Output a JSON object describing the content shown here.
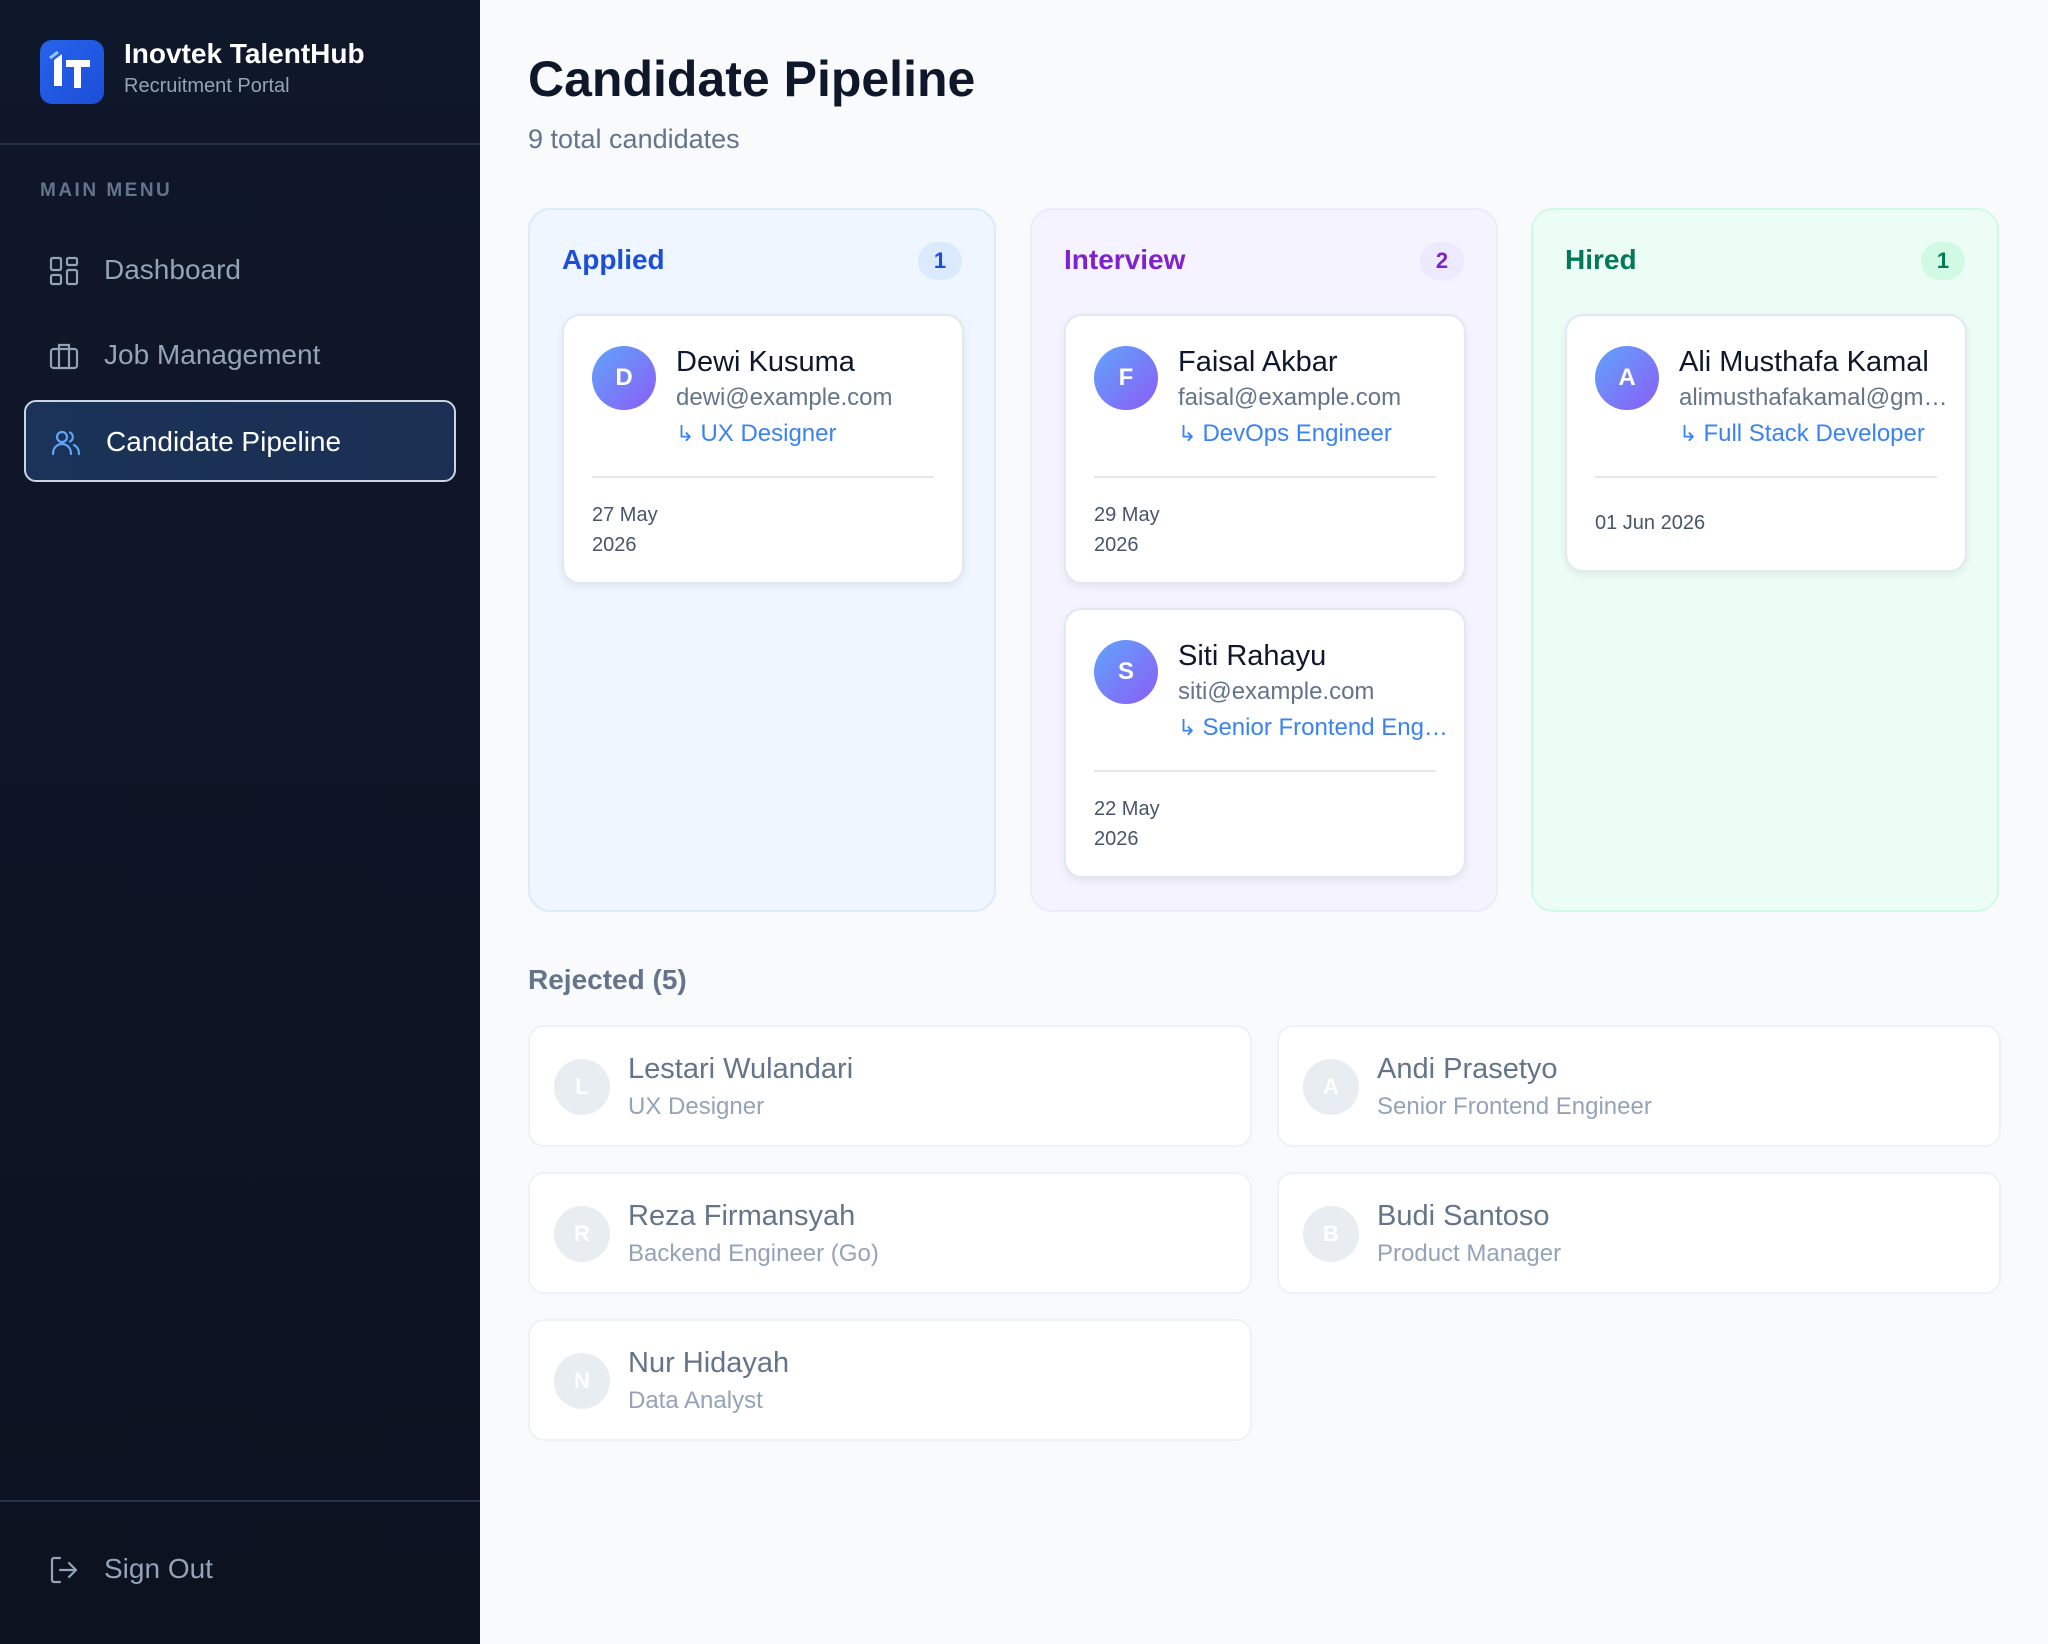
{
  "brand": {
    "name": "Inovtek TalentHub",
    "subtitle": "Recruitment Portal",
    "logo_icon": "it-logo-icon"
  },
  "sidebar": {
    "heading": "MAIN MENU",
    "items": [
      {
        "label": "Dashboard",
        "icon": "grid-icon",
        "active": false
      },
      {
        "label": "Job Management",
        "icon": "briefcase-icon",
        "active": false
      },
      {
        "label": "Candidate Pipeline",
        "icon": "users-icon",
        "active": true
      }
    ],
    "signout": {
      "label": "Sign Out",
      "icon": "sign-out-icon"
    }
  },
  "header": {
    "title": "Candidate Pipeline",
    "subtitle": "9 total candidates"
  },
  "columns": [
    {
      "title": "Applied",
      "count": "1",
      "color": "#1d4ed8",
      "cards": [
        {
          "initial": "D",
          "name": "Dewi Kusuma",
          "email": "dewi@example.com",
          "role": "UX Designer",
          "date": "27 May 2026"
        }
      ]
    },
    {
      "title": "Interview",
      "count": "2",
      "color": "#7e22ce",
      "cards": [
        {
          "initial": "F",
          "name": "Faisal Akbar",
          "email": "faisal@example.com",
          "role": "DevOps Engineer",
          "date": "29 May 2026"
        },
        {
          "initial": "S",
          "name": "Siti Rahayu",
          "email": "siti@example.com",
          "role": "Senior Frontend Engineer",
          "date": "22 May 2026"
        }
      ]
    },
    {
      "title": "Hired",
      "count": "1",
      "color": "#047857",
      "cards": [
        {
          "initial": "A",
          "name": "Ali Musthafa Kamal",
          "email": "alimusthafakamal@gmail.com",
          "role": "Full Stack Developer",
          "date": "01 Jun 2026"
        }
      ]
    }
  ],
  "rejected": {
    "title": "Rejected (5)",
    "items": [
      {
        "initial": "L",
        "name": "Lestari Wulandari",
        "role": "UX Designer"
      },
      {
        "initial": "A",
        "name": "Andi Prasetyo",
        "role": "Senior Frontend Engineer"
      },
      {
        "initial": "R",
        "name": "Reza Firmansyah",
        "role": "Backend Engineer (Go)"
      },
      {
        "initial": "B",
        "name": "Budi Santoso",
        "role": "Product Manager"
      },
      {
        "initial": "N",
        "name": "Nur Hidayah",
        "role": "Data Analyst"
      }
    ]
  },
  "colors": {
    "sidebar_bg": "#0f172a",
    "accent": "#3b82f6",
    "active_nav": "#1e3a5f"
  }
}
